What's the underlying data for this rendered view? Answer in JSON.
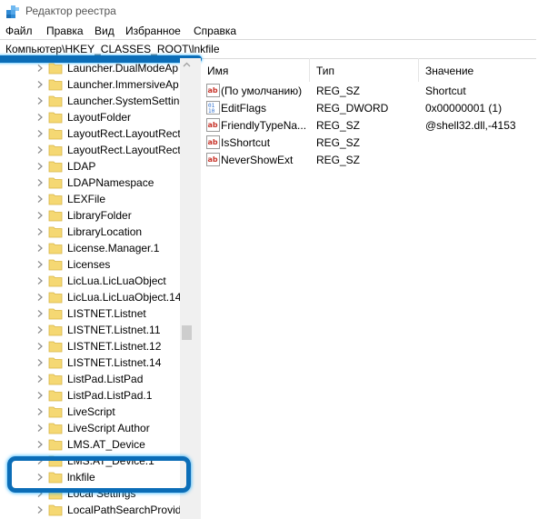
{
  "window": {
    "title": "Редактор реестра"
  },
  "menu": [
    "Файл",
    "Правка",
    "Вид",
    "Избранное",
    "Справка"
  ],
  "address": "Компьютер\\HKEY_CLASSES_ROOT\\lnkfile",
  "tree": {
    "items": [
      {
        "label": "Launcher.DualModeAp"
      },
      {
        "label": "Launcher.ImmersiveAp"
      },
      {
        "label": "Launcher.SystemSetting"
      },
      {
        "label": "LayoutFolder"
      },
      {
        "label": "LayoutRect.LayoutRect"
      },
      {
        "label": "LayoutRect.LayoutRect."
      },
      {
        "label": "LDAP"
      },
      {
        "label": "LDAPNamespace"
      },
      {
        "label": "LEXFile"
      },
      {
        "label": "LibraryFolder"
      },
      {
        "label": "LibraryLocation"
      },
      {
        "label": "License.Manager.1"
      },
      {
        "label": "Licenses"
      },
      {
        "label": "LicLua.LicLuaObject"
      },
      {
        "label": "LicLua.LicLuaObject.14"
      },
      {
        "label": "LISTNET.Listnet"
      },
      {
        "label": "LISTNET.Listnet.11"
      },
      {
        "label": "LISTNET.Listnet.12"
      },
      {
        "label": "LISTNET.Listnet.14"
      },
      {
        "label": "ListPad.ListPad"
      },
      {
        "label": "ListPad.ListPad.1"
      },
      {
        "label": "LiveScript"
      },
      {
        "label": "LiveScript Author"
      },
      {
        "label": "LMS.AT_Device"
      },
      {
        "label": "LMS.AT_Device.1"
      },
      {
        "label": "lnkfile"
      },
      {
        "label": "Local Settings"
      },
      {
        "label": "LocalPathSearchProvide"
      }
    ]
  },
  "list": {
    "headers": {
      "name": "Имя",
      "type": "Тип",
      "data": "Значение"
    },
    "rows": [
      {
        "icon": "string-value-icon",
        "name": "(По умолчанию)",
        "type": "REG_SZ",
        "data": "Shortcut"
      },
      {
        "icon": "binary-value-icon",
        "name": "EditFlags",
        "type": "REG_DWORD",
        "data": "0x00000001 (1)"
      },
      {
        "icon": "string-value-icon",
        "name": "FriendlyTypeNa...",
        "type": "REG_SZ",
        "data": "@shell32.dll,-4153"
      },
      {
        "icon": "string-value-icon",
        "name": "IsShortcut",
        "type": "REG_SZ",
        "data": ""
      },
      {
        "icon": "string-value-icon",
        "name": "NeverShowExt",
        "type": "REG_SZ",
        "data": ""
      }
    ]
  },
  "colors": {
    "highlight": "#0b6db7",
    "folder": "#f5d873",
    "ab_icon": "#c8352b",
    "dword_icon": "#2f6fcf"
  }
}
